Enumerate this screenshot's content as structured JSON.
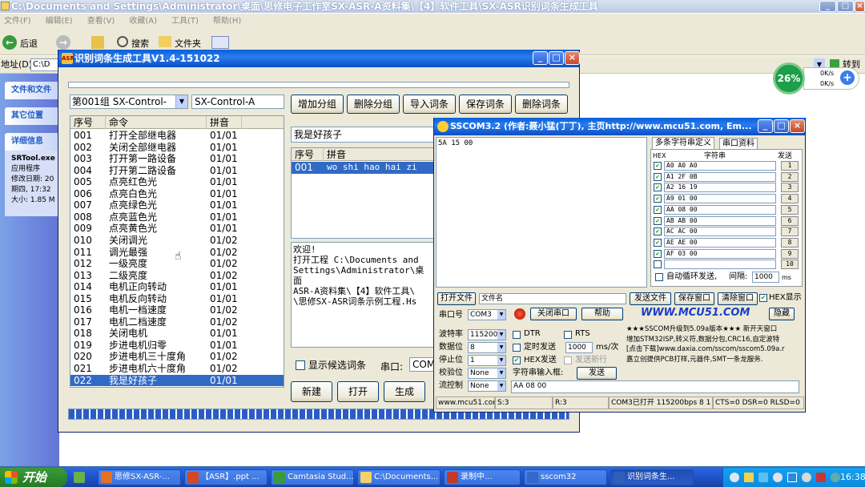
{
  "explorer": {
    "title": "C:\\Documents and Settings\\Administrator\\桌面\\思修电子工作室SX-ASR-A资料集\\【4】软件工具\\SX-ASR识别词条生成工具",
    "menu": [
      "文件(F)",
      "编辑(E)",
      "查看(V)",
      "收藏(A)",
      "工具(T)",
      "帮助(H)"
    ],
    "toolbar": {
      "back": "后退",
      "search": "搜索",
      "folders": "文件夹"
    },
    "address_label": "地址(D)",
    "address_value": "C:\\D",
    "go_label": "转到",
    "tasks": {
      "file_tasks": "文件和文件",
      "other_places": "其它位置",
      "details": "详细信息",
      "detail_name": "SRTool.exe",
      "detail_type": "应用程序",
      "detail_modified": "修改日期: 20",
      "detail_time": "期四, 17:32",
      "detail_size": "大小: 1.85 M"
    }
  },
  "netmeter": {
    "percent": "26%",
    "up": "0K/s",
    "down": "0K/s"
  },
  "gen": {
    "title": "识别词条生成工具V1.4-151022",
    "group_combo": "第001组  SX-Control-",
    "group_name": "SX-Control-A",
    "buttons": {
      "add_group": "增加分组",
      "del_group": "删除分组",
      "import": "导入词条",
      "save": "保存词条",
      "del_entry": "删除词条",
      "new": "新建",
      "open": "打开",
      "generate": "生成"
    },
    "columns": [
      "序号",
      "命令",
      "拼音"
    ],
    "rows": [
      [
        "001",
        "打开全部继电器",
        "01/01"
      ],
      [
        "002",
        "关闭全部继电器",
        "01/01"
      ],
      [
        "003",
        "打开第一路设备",
        "01/01"
      ],
      [
        "004",
        "打开第二路设备",
        "01/01"
      ],
      [
        "005",
        "点亮红色光",
        "01/01"
      ],
      [
        "006",
        "点亮白色光",
        "01/01"
      ],
      [
        "007",
        "点亮绿色光",
        "01/01"
      ],
      [
        "008",
        "点亮蓝色光",
        "01/01"
      ],
      [
        "009",
        "点亮黄色光",
        "01/01"
      ],
      [
        "010",
        "关闭调光",
        "01/02"
      ],
      [
        "011",
        "调光最强",
        "01/02"
      ],
      [
        "012",
        "一级亮度",
        "01/02"
      ],
      [
        "013",
        "二级亮度",
        "01/02"
      ],
      [
        "014",
        "电机正向转动",
        "01/01"
      ],
      [
        "015",
        "电机反向转动",
        "01/01"
      ],
      [
        "016",
        "电机一档速度",
        "01/02"
      ],
      [
        "017",
        "电机二档速度",
        "01/02"
      ],
      [
        "018",
        "关闭电机",
        "01/01"
      ],
      [
        "019",
        "步进电机归零",
        "01/01"
      ],
      [
        "020",
        "步进电机三十度角",
        "01/02"
      ],
      [
        "021",
        "步进电机六十度角",
        "01/02"
      ],
      [
        "022",
        "我是好孩子",
        "01/01"
      ]
    ],
    "selected_row": 21,
    "phrase_input": "我是好孩子",
    "pinyin_columns": [
      "序号",
      "拼音"
    ],
    "pinyin_rows": [
      [
        "001",
        "wo shi hao hai zi"
      ]
    ],
    "log": [
      "欢迎!",
      "打开工程 C:\\Documents and",
      "Settings\\Administrator\\桌面",
      "ASR-A资料集\\【4】软件工具\\",
      "\\思修SX-ASR词条示例工程.Hs"
    ],
    "show_candidates": "显示候选词条",
    "port_label": "串口:",
    "port_value": "COM3"
  },
  "ss": {
    "title": "SSCOM3.2 (作者:聂小猛(丁丁), 主页http://www.mcu51.com, Em...",
    "recv": "5A 15 00",
    "tab_multi": "多条字符串定义",
    "tab_port": "串口资料",
    "hex_col": "HEX",
    "str_col": "字符串",
    "send_col": "发送",
    "multi": [
      [
        "A0 A0 A0",
        "1"
      ],
      [
        "A1 2F 0B",
        "2"
      ],
      [
        "A2 16 19",
        "3"
      ],
      [
        "A9 01 00",
        "4"
      ],
      [
        "AA 08 00",
        "5"
      ],
      [
        "AB AB 00",
        "6"
      ],
      [
        "AC AC 00",
        "7"
      ],
      [
        "AE AE 00",
        "8"
      ],
      [
        "AF 03 00",
        "9"
      ],
      [
        "",
        "10"
      ]
    ],
    "auto_loop": "自动循环发送,",
    "interval_label": "间隔:",
    "interval_value": "1000",
    "interval_unit": "ms",
    "open_file": "打开文件",
    "file_name": "文件名",
    "send_file": "发送文件",
    "save_window": "保存窗口",
    "clear_window": "清除窗口",
    "hex_display": "HEX显示",
    "port_label": "串口号",
    "port_value": "COM3",
    "close_port": "关闭串口",
    "help": "帮助",
    "brand": "WWW.MCU51.COM",
    "hide": "隐藏",
    "baud_label": "波特率",
    "baud_value": "115200",
    "data_label": "数据位",
    "data_value": "8",
    "stop_label": "停止位",
    "stop_value": "1",
    "parity_label": "校验位",
    "parity_value": "None",
    "flow_label": "流控制",
    "flow_value": "None",
    "dtr": "DTR",
    "rts": "RTS",
    "timed_send": "定时发送",
    "timed_value": "1000",
    "timed_unit": "ms/次",
    "hex_send": "HEX发送",
    "send_newline": "发送新行",
    "input_label": "字符串输入框:",
    "send": "发送",
    "send_input": "AA 08 00",
    "ad_lines": [
      "★★★SSCOM升级到5.09a版本★★★ 新开天窗口",
      "增加STM32ISP,转义符,数据分包,CRC16,自定波特",
      "[点击下载]www.daxia.com/sscom/sscom5.09a.r",
      "嘉立创提供PCB打样,元器件,SMT一条龙服务."
    ],
    "status": [
      "www.mcu51.com",
      "S:3",
      "R:3",
      "COM3已打开 115200bps 8 1",
      "CTS=0 DSR=0 RLSD=0"
    ]
  },
  "taskbar": {
    "start": "开始",
    "items": [
      "思修SX-ASR-...",
      "【ASR】.ppt ...",
      "Camtasia Stud...",
      "C:\\Documents...",
      "录制中...",
      "sscom32",
      "识别词条生..."
    ],
    "active_index": 6,
    "clock": "16:38"
  },
  "colors": {
    "xp_blue": "#0a5fd8",
    "selection": "#316ac5",
    "taskbar": "#245edb",
    "start_green": "#2f8b2f"
  }
}
